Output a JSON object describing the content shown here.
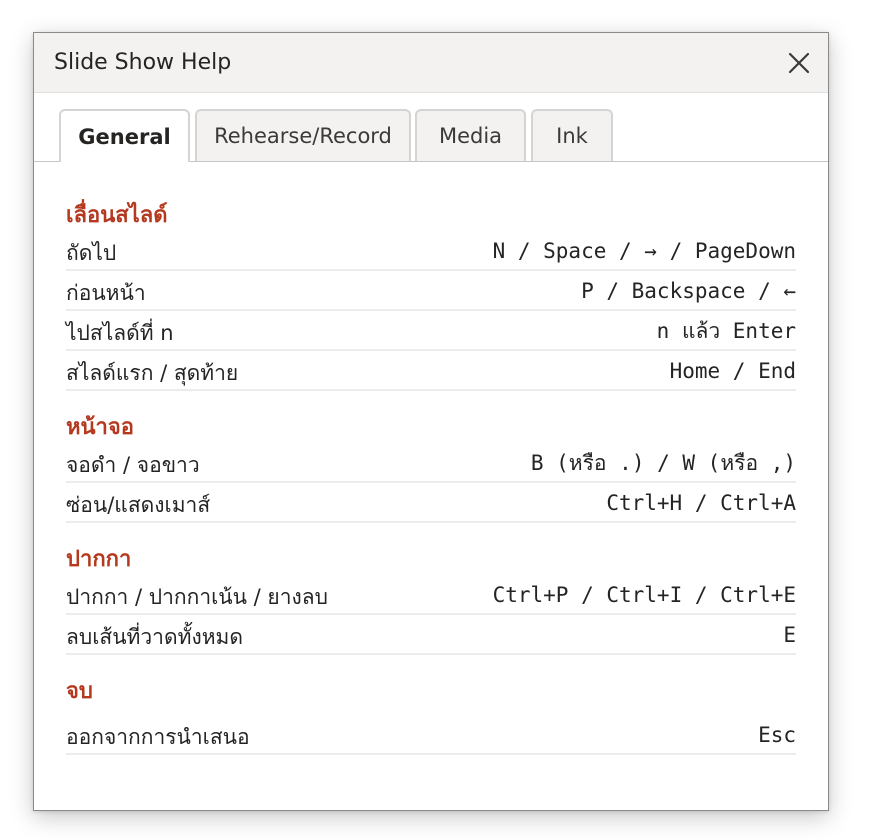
{
  "dialog": {
    "title": "Slide Show Help",
    "close_icon": "close-icon"
  },
  "tabs": [
    {
      "label": "General",
      "active": true
    },
    {
      "label": "Rehearse/Record",
      "active": false
    },
    {
      "label": "Media",
      "active": false
    },
    {
      "label": "Ink",
      "active": false
    }
  ],
  "colors": {
    "heading": "#b5391f",
    "titlebar_bg": "#f3f2f1",
    "tab_bg": "#f3f2f1",
    "text": "#252423"
  },
  "sections": [
    {
      "heading": "เลื่อนสไลด์",
      "rows": [
        {
          "label": "ถัดไป",
          "keys": "N / Space / → / PageDown"
        },
        {
          "label": "ก่อนหน้า",
          "keys": "P / Backspace / ←"
        },
        {
          "label": "ไปสไลด์ที่ n",
          "keys": "n แล้ว Enter"
        },
        {
          "label": "สไลด์แรก / สุดท้าย",
          "keys": "Home / End"
        }
      ]
    },
    {
      "heading": "หน้าจอ",
      "rows": [
        {
          "label": "จอดำ / จอขาว",
          "keys": "B (หรือ .) / W (หรือ ,)"
        },
        {
          "label": "ซ่อน/แสดงเมาส์",
          "keys": "Ctrl+H / Ctrl+A"
        }
      ]
    },
    {
      "heading": "ปากกา",
      "rows": [
        {
          "label": "ปากกา / ปากกาเน้น / ยางลบ",
          "keys": "Ctrl+P / Ctrl+I / Ctrl+E"
        },
        {
          "label": "ลบเส้นที่วาดทั้งหมด",
          "keys": "E"
        }
      ]
    },
    {
      "heading": "จบ",
      "rows": [
        {
          "label": "ออกจากการนำเสนอ",
          "keys": "Esc"
        }
      ]
    }
  ]
}
